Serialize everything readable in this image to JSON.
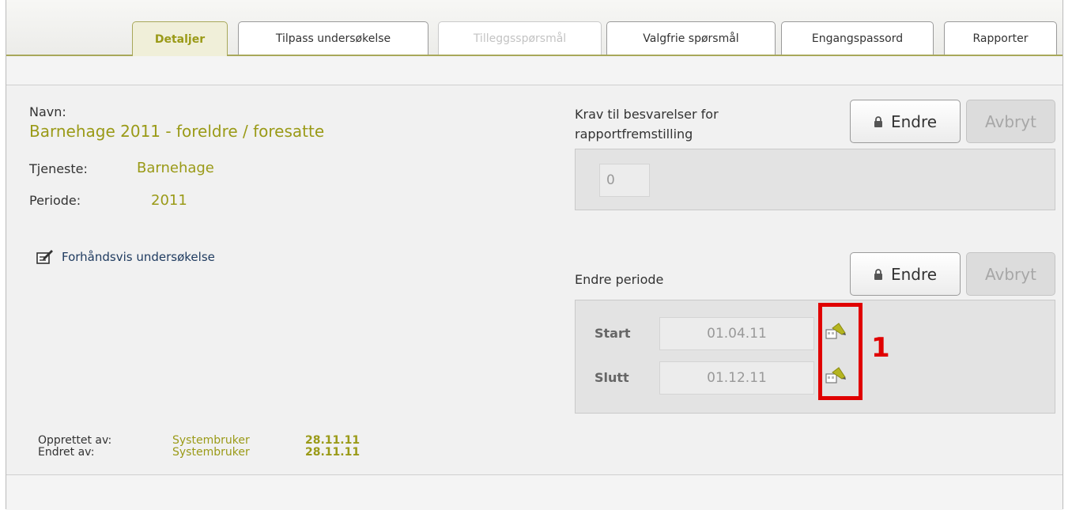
{
  "tabs": [
    {
      "label": "Detaljer"
    },
    {
      "label": "Tilpass undersøkelse"
    },
    {
      "label": "Tilleggsspørsmål"
    },
    {
      "label": "Valgfrie spørsmål"
    },
    {
      "label": "Engangspassord"
    },
    {
      "label": "Rapporter"
    }
  ],
  "details": {
    "navn_label": "Navn:",
    "navn_value": "Barnehage 2011 - foreldre / foresatte",
    "tjeneste_label": "Tjeneste:",
    "tjeneste_value": "Barnehage",
    "periode_label": "Periode:",
    "periode_value": "2011",
    "preview_link": "Forhåndsvis undersøkelse",
    "preview_icon": "preview-edit-icon"
  },
  "krav": {
    "label_line1": "Krav til besvarelser for",
    "label_line2": "rapportfremstilling",
    "value": "0",
    "edit_button": "Endre",
    "cancel_button": "Avbryt",
    "lock_icon": "lock-icon"
  },
  "periode": {
    "label": "Endre periode",
    "edit_button": "Endre",
    "cancel_button": "Avbryt",
    "start_label": "Start",
    "start_value": "01.04.11",
    "slutt_label": "Slutt",
    "slutt_value": "01.12.11",
    "calendar_icon": "calendar-pen-icon"
  },
  "annotation": {
    "number": "1",
    "color": "#e00000"
  },
  "footer": {
    "opprettet_label": "Opprettet av:",
    "opprettet_user": "Systembruker",
    "opprettet_date": "28.11.11",
    "endret_label": "Endret av:",
    "endret_user": "Systembruker",
    "endret_date": "28.11.11"
  },
  "colors": {
    "accent": "#9a9a17",
    "link": "#1e3a5f",
    "highlight": "#e00000"
  }
}
